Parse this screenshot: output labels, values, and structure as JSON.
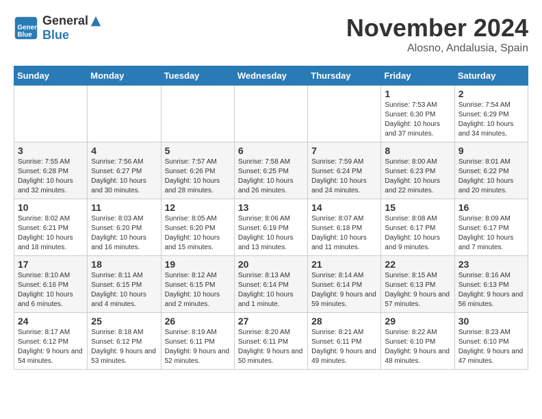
{
  "header": {
    "logo_line1": "General",
    "logo_line2": "Blue",
    "month_title": "November 2024",
    "location": "Alosno, Andalusia, Spain"
  },
  "days_of_week": [
    "Sunday",
    "Monday",
    "Tuesday",
    "Wednesday",
    "Thursday",
    "Friday",
    "Saturday"
  ],
  "weeks": [
    [
      {
        "day": "",
        "info": ""
      },
      {
        "day": "",
        "info": ""
      },
      {
        "day": "",
        "info": ""
      },
      {
        "day": "",
        "info": ""
      },
      {
        "day": "",
        "info": ""
      },
      {
        "day": "1",
        "info": "Sunrise: 7:53 AM\nSunset: 6:30 PM\nDaylight: 10 hours and 37 minutes."
      },
      {
        "day": "2",
        "info": "Sunrise: 7:54 AM\nSunset: 6:29 PM\nDaylight: 10 hours and 34 minutes."
      }
    ],
    [
      {
        "day": "3",
        "info": "Sunrise: 7:55 AM\nSunset: 6:28 PM\nDaylight: 10 hours and 32 minutes."
      },
      {
        "day": "4",
        "info": "Sunrise: 7:56 AM\nSunset: 6:27 PM\nDaylight: 10 hours and 30 minutes."
      },
      {
        "day": "5",
        "info": "Sunrise: 7:57 AM\nSunset: 6:26 PM\nDaylight: 10 hours and 28 minutes."
      },
      {
        "day": "6",
        "info": "Sunrise: 7:58 AM\nSunset: 6:25 PM\nDaylight: 10 hours and 26 minutes."
      },
      {
        "day": "7",
        "info": "Sunrise: 7:59 AM\nSunset: 6:24 PM\nDaylight: 10 hours and 24 minutes."
      },
      {
        "day": "8",
        "info": "Sunrise: 8:00 AM\nSunset: 6:23 PM\nDaylight: 10 hours and 22 minutes."
      },
      {
        "day": "9",
        "info": "Sunrise: 8:01 AM\nSunset: 6:22 PM\nDaylight: 10 hours and 20 minutes."
      }
    ],
    [
      {
        "day": "10",
        "info": "Sunrise: 8:02 AM\nSunset: 6:21 PM\nDaylight: 10 hours and 18 minutes."
      },
      {
        "day": "11",
        "info": "Sunrise: 8:03 AM\nSunset: 6:20 PM\nDaylight: 10 hours and 16 minutes."
      },
      {
        "day": "12",
        "info": "Sunrise: 8:05 AM\nSunset: 6:20 PM\nDaylight: 10 hours and 15 minutes."
      },
      {
        "day": "13",
        "info": "Sunrise: 8:06 AM\nSunset: 6:19 PM\nDaylight: 10 hours and 13 minutes."
      },
      {
        "day": "14",
        "info": "Sunrise: 8:07 AM\nSunset: 6:18 PM\nDaylight: 10 hours and 11 minutes."
      },
      {
        "day": "15",
        "info": "Sunrise: 8:08 AM\nSunset: 6:17 PM\nDaylight: 10 hours and 9 minutes."
      },
      {
        "day": "16",
        "info": "Sunrise: 8:09 AM\nSunset: 6:17 PM\nDaylight: 10 hours and 7 minutes."
      }
    ],
    [
      {
        "day": "17",
        "info": "Sunrise: 8:10 AM\nSunset: 6:16 PM\nDaylight: 10 hours and 6 minutes."
      },
      {
        "day": "18",
        "info": "Sunrise: 8:11 AM\nSunset: 6:15 PM\nDaylight: 10 hours and 4 minutes."
      },
      {
        "day": "19",
        "info": "Sunrise: 8:12 AM\nSunset: 6:15 PM\nDaylight: 10 hours and 2 minutes."
      },
      {
        "day": "20",
        "info": "Sunrise: 8:13 AM\nSunset: 6:14 PM\nDaylight: 10 hours and 1 minute."
      },
      {
        "day": "21",
        "info": "Sunrise: 8:14 AM\nSunset: 6:14 PM\nDaylight: 9 hours and 59 minutes."
      },
      {
        "day": "22",
        "info": "Sunrise: 8:15 AM\nSunset: 6:13 PM\nDaylight: 9 hours and 57 minutes."
      },
      {
        "day": "23",
        "info": "Sunrise: 8:16 AM\nSunset: 6:13 PM\nDaylight: 9 hours and 56 minutes."
      }
    ],
    [
      {
        "day": "24",
        "info": "Sunrise: 8:17 AM\nSunset: 6:12 PM\nDaylight: 9 hours and 54 minutes."
      },
      {
        "day": "25",
        "info": "Sunrise: 8:18 AM\nSunset: 6:12 PM\nDaylight: 9 hours and 53 minutes."
      },
      {
        "day": "26",
        "info": "Sunrise: 8:19 AM\nSunset: 6:11 PM\nDaylight: 9 hours and 52 minutes."
      },
      {
        "day": "27",
        "info": "Sunrise: 8:20 AM\nSunset: 6:11 PM\nDaylight: 9 hours and 50 minutes."
      },
      {
        "day": "28",
        "info": "Sunrise: 8:21 AM\nSunset: 6:11 PM\nDaylight: 9 hours and 49 minutes."
      },
      {
        "day": "29",
        "info": "Sunrise: 8:22 AM\nSunset: 6:10 PM\nDaylight: 9 hours and 48 minutes."
      },
      {
        "day": "30",
        "info": "Sunrise: 8:23 AM\nSunset: 6:10 PM\nDaylight: 9 hours and 47 minutes."
      }
    ]
  ]
}
